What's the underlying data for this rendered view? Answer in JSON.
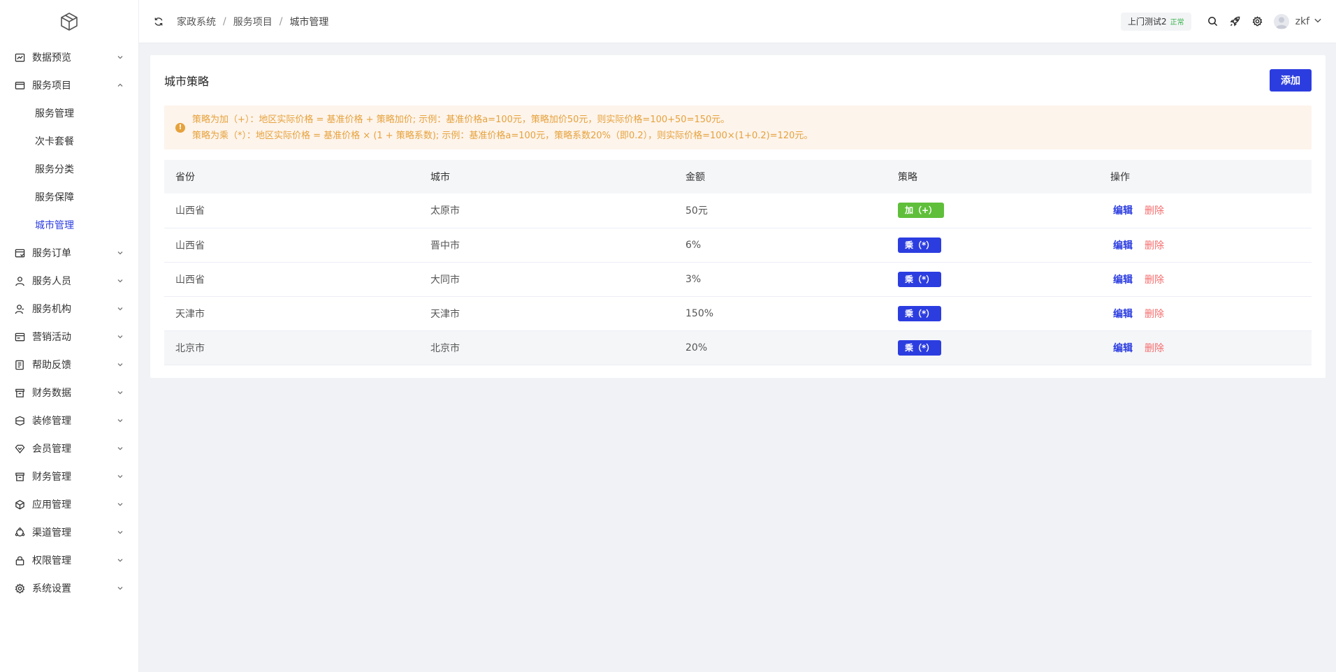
{
  "sidebar": {
    "logo": "cube-logo",
    "items": [
      {
        "label": "数据预览",
        "icon": "chart-icon",
        "expanded": false
      },
      {
        "label": "服务项目",
        "icon": "wallet-icon",
        "expanded": true,
        "children": [
          "服务管理",
          "次卡套餐",
          "服务分类",
          "服务保障",
          "城市管理"
        ]
      },
      {
        "label": "服务订单",
        "icon": "order-icon",
        "expanded": false
      },
      {
        "label": "服务人员",
        "icon": "user-icon",
        "expanded": false
      },
      {
        "label": "服务机构",
        "icon": "org-icon",
        "expanded": false
      },
      {
        "label": "营销活动",
        "icon": "marketing-icon",
        "expanded": false
      },
      {
        "label": "帮助反馈",
        "icon": "feedback-icon",
        "expanded": false
      },
      {
        "label": "财务数据",
        "icon": "finance-data-icon",
        "expanded": false
      },
      {
        "label": "装修管理",
        "icon": "decor-icon",
        "expanded": false
      },
      {
        "label": "会员管理",
        "icon": "member-icon",
        "expanded": false
      },
      {
        "label": "财务管理",
        "icon": "finance-icon",
        "expanded": false
      },
      {
        "label": "应用管理",
        "icon": "app-icon",
        "expanded": false
      },
      {
        "label": "渠道管理",
        "icon": "channel-icon",
        "expanded": false
      },
      {
        "label": "权限管理",
        "icon": "lock-icon",
        "expanded": false
      },
      {
        "label": "系统设置",
        "icon": "gear-icon",
        "expanded": false
      }
    ],
    "active_child": "城市管理"
  },
  "header": {
    "breadcrumb": [
      "家政系统",
      "服务项目",
      "城市管理"
    ],
    "tenant_name": "上门测试2",
    "tenant_status": "正常",
    "username": "zkf"
  },
  "card": {
    "title": "城市策略",
    "add_label": "添加",
    "notice_lines": [
      "策略为加（+）：地区实际价格 = 基准价格 + 策略加价; 示例：基准价格a=100元，策略加价50元，则实际价格=100+50=150元。",
      "策略为乘（*）：地区实际价格 = 基准价格 × (1 + 策略系数); 示例：基准价格a=100元，策略系数20%（即0.2），则实际价格=100×(1+0.2)=120元。"
    ]
  },
  "table": {
    "columns": [
      "省份",
      "城市",
      "金额",
      "策略",
      "操作"
    ],
    "rows": [
      {
        "province": "山西省",
        "city": "太原市",
        "amount": "50元",
        "strategy": "加（+）",
        "type": "plus"
      },
      {
        "province": "山西省",
        "city": "晋中市",
        "amount": "6%",
        "strategy": "乘（*）",
        "type": "mul"
      },
      {
        "province": "山西省",
        "city": "大同市",
        "amount": "3%",
        "strategy": "乘（*）",
        "type": "mul"
      },
      {
        "province": "天津市",
        "city": "天津市",
        "amount": "150%",
        "strategy": "乘（*）",
        "type": "mul"
      },
      {
        "province": "北京市",
        "city": "北京市",
        "amount": "20%",
        "strategy": "乘（*）",
        "type": "mul"
      }
    ],
    "edit_label": "编辑",
    "delete_label": "删除"
  },
  "colors": {
    "primary": "#2c3de0",
    "plus_tag": "#5fbf3a",
    "warning": "#e6a23c",
    "danger": "#f56c6c"
  }
}
